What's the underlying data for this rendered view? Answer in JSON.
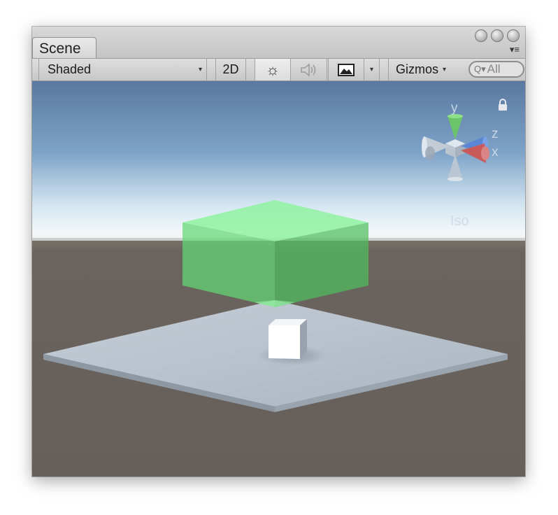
{
  "window": {
    "tab_label": "Scene",
    "menu_glyph": "▾≡"
  },
  "toolbar": {
    "draw_mode": {
      "selected": "Shaded",
      "arrow": "▾"
    },
    "toggle_2d": "2D",
    "lighting_glyph": "☼",
    "audio_glyph": "🔊",
    "effects_arrow": "▾",
    "gizmos": {
      "label": "Gizmos",
      "arrow": "▾"
    },
    "search": {
      "value": "All",
      "icon_glyph": "Q▾"
    }
  },
  "scene_gizmo": {
    "axes": {
      "y": "y",
      "z": "z",
      "x": "x"
    },
    "projection_label": "Iso",
    "colors": {
      "y": "#7fd07a",
      "x": "#d46a6a",
      "z": "#5a86d6"
    }
  },
  "scene": {
    "sky_top": "#5c7aa0",
    "horizon": "#f2f6f8",
    "ground": "#6a625c",
    "trigger_box_color": "#6fe37c",
    "plane_color": "#b4bfcb",
    "cube_color": "#ffffff"
  },
  "icons": [
    "lock-icon",
    "sun-icon",
    "speaker-icon",
    "image-icon",
    "search-icon"
  ]
}
